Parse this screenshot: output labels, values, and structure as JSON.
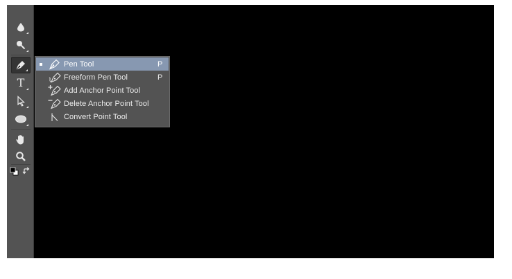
{
  "toolbar": {
    "tools": [
      {
        "name": "drop-icon"
      },
      {
        "name": "dodge-icon"
      },
      {
        "name": "pen-icon",
        "active": true
      },
      {
        "name": "type-icon",
        "glyph": "T"
      },
      {
        "name": "path-selection-icon"
      },
      {
        "name": "ellipse-icon"
      },
      {
        "name": "hand-icon"
      },
      {
        "name": "zoom-icon"
      },
      {
        "name": "default-colors-icon"
      },
      {
        "name": "swap-colors-icon"
      }
    ]
  },
  "flyout": {
    "items": [
      {
        "label": "Pen Tool",
        "shortcut": "P",
        "icon": "pen-icon",
        "selected": true
      },
      {
        "label": "Freeform Pen Tool",
        "shortcut": "P",
        "icon": "freeform-pen-icon",
        "selected": false
      },
      {
        "label": "Add Anchor Point Tool",
        "shortcut": "",
        "icon": "add-anchor-point-icon",
        "selected": false
      },
      {
        "label": "Delete Anchor Point Tool",
        "shortcut": "",
        "icon": "delete-anchor-point-icon",
        "selected": false
      },
      {
        "label": "Convert Point Tool",
        "shortcut": "",
        "icon": "convert-point-icon",
        "selected": false
      }
    ]
  },
  "colors": {
    "canvas": "#000000",
    "panel": "#535353",
    "highlight": "#8798b1",
    "text": "#ececec"
  }
}
